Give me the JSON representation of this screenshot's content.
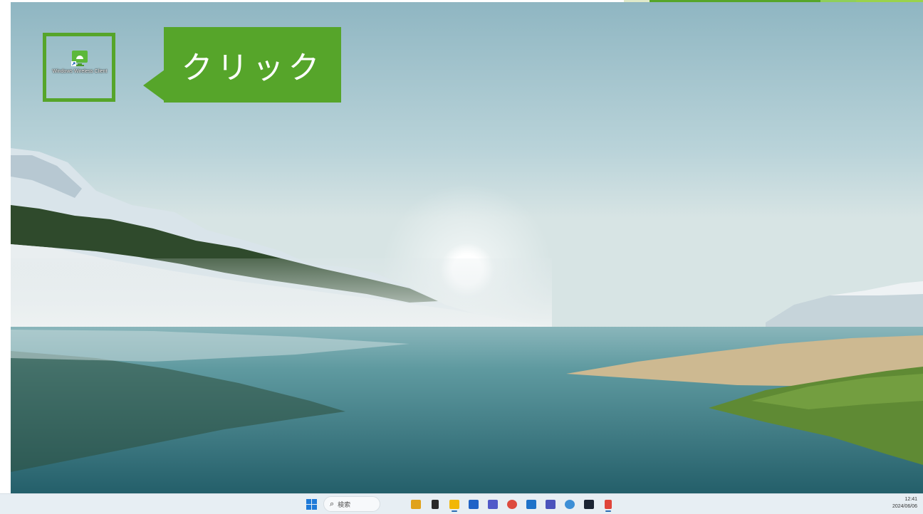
{
  "callout": {
    "text": "クリック"
  },
  "desktop_icon": {
    "label": "Windows Wireless Client",
    "icon": "wireless-monitor-icon"
  },
  "taskbar": {
    "start_icon": "windows-start-icon",
    "search_placeholder": "検索",
    "apps": [
      {
        "name": "briefcase-app-icon",
        "color": "#e0a21a"
      },
      {
        "name": "task-view-icon",
        "color": "#2a2a2a"
      },
      {
        "name": "file-explorer-icon",
        "color": "#f2b705"
      },
      {
        "name": "store-icon",
        "color": "#1f63c7"
      },
      {
        "name": "teams-icon",
        "color": "#5059c9"
      },
      {
        "name": "chrome-icon",
        "color": "#dd4b3e"
      },
      {
        "name": "outlook-icon",
        "color": "#1e72c9"
      },
      {
        "name": "teams-classic-icon",
        "color": "#4b53bc"
      },
      {
        "name": "settings-app-icon",
        "color": "#3d8fd6"
      },
      {
        "name": "terminal-icon",
        "color": "#1b2433"
      },
      {
        "name": "snipping-tool-icon",
        "color": "#e0453a"
      }
    ],
    "clock_time": "12:41",
    "clock_date": "2024/06/06"
  },
  "colors": {
    "accent_green": "#56a52a",
    "taskbar_bg": "#e7eef3"
  }
}
